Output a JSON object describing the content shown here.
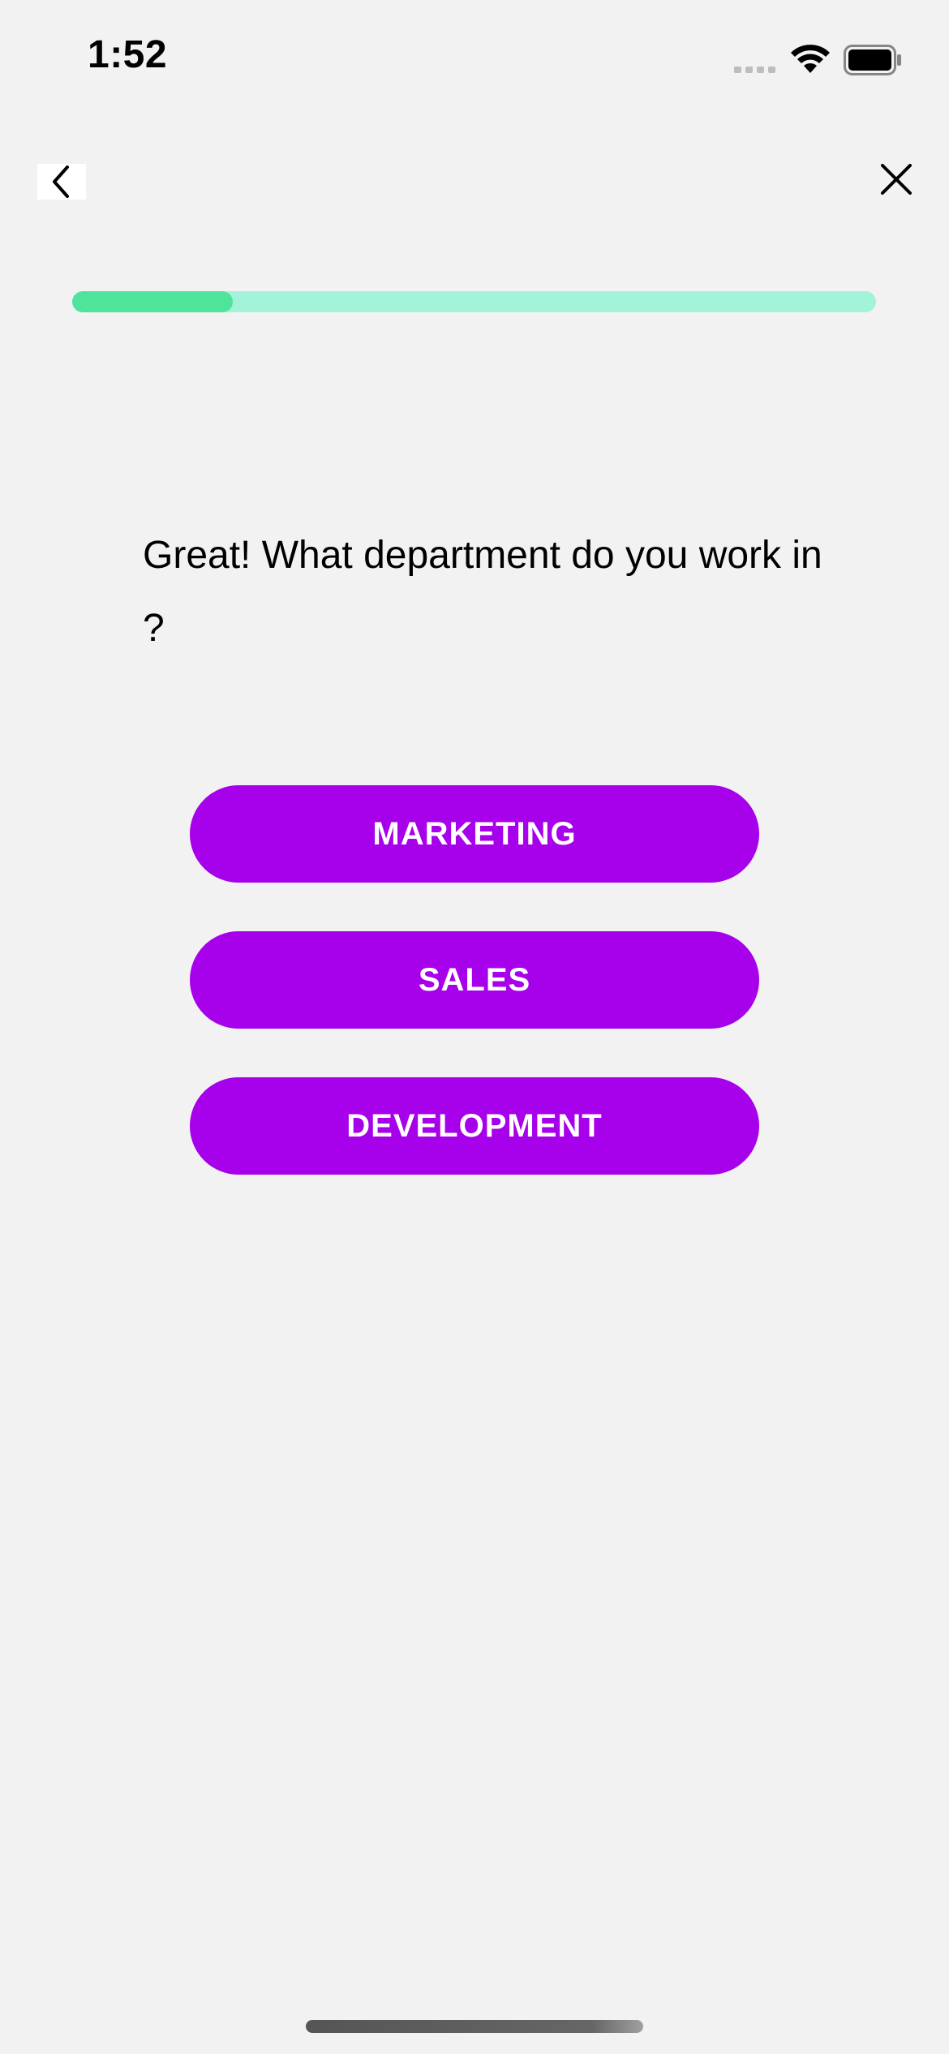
{
  "status_bar": {
    "time": "1:52",
    "icons": [
      "cellular-signal-icon",
      "wifi-icon",
      "battery-icon"
    ]
  },
  "nav": {
    "back_icon": "chevron-left-icon",
    "close_icon": "close-icon"
  },
  "progress": {
    "fraction": 0.2
  },
  "question": {
    "text": "Great! What department do you work in ?"
  },
  "options": [
    {
      "label": "MARKETING"
    },
    {
      "label": "SALES"
    },
    {
      "label": "DEVELOPMENT"
    }
  ],
  "colors": {
    "background": "#f2f2f2",
    "button": "#a700ea",
    "button_text": "#ffffff",
    "progress_track": "#a2f3d9",
    "progress_fill": "#4fe39c"
  }
}
